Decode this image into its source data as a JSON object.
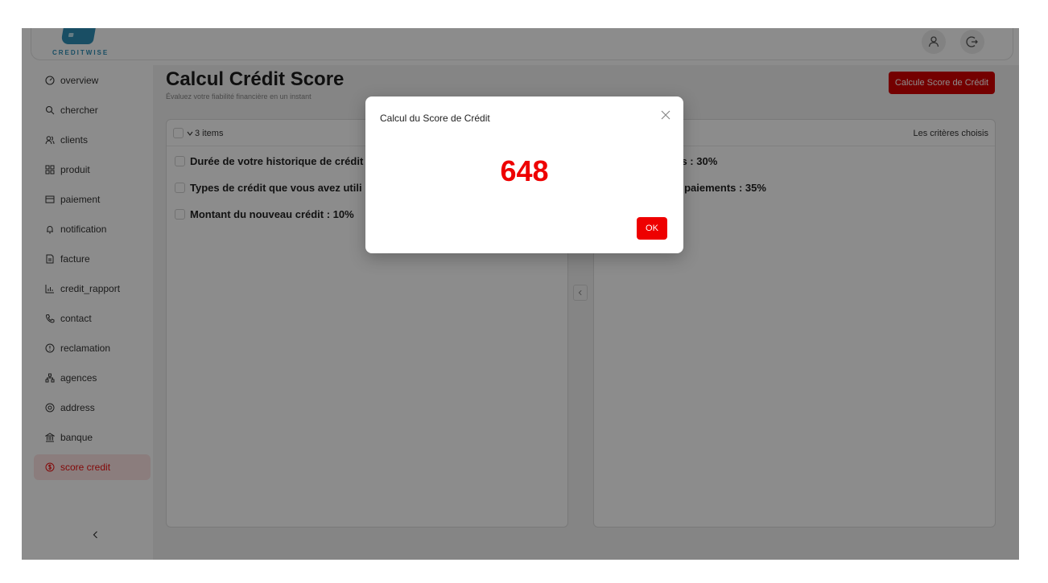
{
  "brand": {
    "name": "CREDITWISE"
  },
  "sidebar": {
    "items": [
      {
        "label": "overview",
        "icon": "dashboard-icon"
      },
      {
        "label": "chercher",
        "icon": "search-icon"
      },
      {
        "label": "clients",
        "icon": "users-icon"
      },
      {
        "label": "produit",
        "icon": "grid-icon"
      },
      {
        "label": "paiement",
        "icon": "card-icon"
      },
      {
        "label": "notification",
        "icon": "bell-icon"
      },
      {
        "label": "facture",
        "icon": "file-icon"
      },
      {
        "label": "credit_rapport",
        "icon": "bar-chart-icon"
      },
      {
        "label": "contact",
        "icon": "phone-icon"
      },
      {
        "label": "reclamation",
        "icon": "alert-icon"
      },
      {
        "label": "agences",
        "icon": "cluster-icon"
      },
      {
        "label": "address",
        "icon": "location-icon"
      },
      {
        "label": "banque",
        "icon": "bank-icon"
      },
      {
        "label": "score credit",
        "icon": "dollar-icon",
        "active": true
      }
    ]
  },
  "page": {
    "title": "Calcul Crédit Score",
    "subtitle": "Évaluez votre fiabilité financière en un instant",
    "calc_button": "Calcule Score de Crédit"
  },
  "left_panel": {
    "count_label": "3 items",
    "items": [
      "Durée de votre historique de crédit",
      "Types de crédit que vous avez utili",
      "Montant du nouveau crédit : 10%"
    ]
  },
  "right_panel": {
    "header": "Les critères choisis",
    "items": [
      "ées : 30%",
      "es paiements : 35%"
    ]
  },
  "modal": {
    "title": "Calcul du Score de Crédit",
    "score": "648",
    "ok": "OK"
  },
  "colors": {
    "accent": "#d40000",
    "brand": "#2e8fb7",
    "active_bg": "#fde3e3"
  }
}
